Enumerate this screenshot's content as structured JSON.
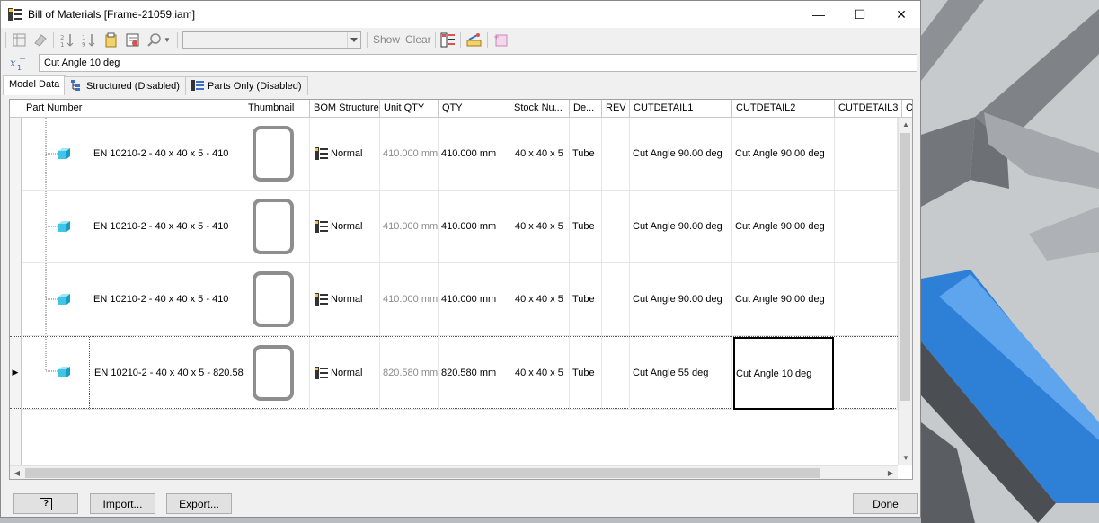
{
  "window": {
    "title": "Bill of Materials [Frame-21059.iam]",
    "minimize_glyph": "—",
    "maximize_glyph": "☐",
    "close_glyph": "✕"
  },
  "toolbar": {
    "view_dropdown_value": "",
    "show_label": "Show",
    "clear_label": "Clear"
  },
  "formula_bar": {
    "value": "Cut Angle 10 deg"
  },
  "tabs": [
    {
      "label": "Model Data",
      "active": true
    },
    {
      "label": "Structured (Disabled)",
      "active": false
    },
    {
      "label": "Parts Only (Disabled)",
      "active": false
    }
  ],
  "grid": {
    "columns": [
      "Part Number",
      "Thumbnail",
      "BOM Structure",
      "Unit QTY",
      "QTY",
      "Stock Nu...",
      "De...",
      "REV",
      "CUTDETAIL1",
      "CUTDETAIL2",
      "CUTDETAIL3",
      "CU"
    ],
    "rows": [
      {
        "part_number": "EN 10210-2 - 40 x 40 x 5 - 410",
        "bom_structure": "Normal",
        "unit_qty": "410.000 mm",
        "qty": "410.000 mm",
        "stock_number": "40 x 40 x 5",
        "description": "Tube",
        "rev": "",
        "cutdetail1": "Cut Angle 90.00 deg",
        "cutdetail2": "Cut Angle 90.00 deg",
        "cutdetail3": ""
      },
      {
        "part_number": "EN 10210-2 - 40 x 40 x 5 - 410",
        "bom_structure": "Normal",
        "unit_qty": "410.000 mm",
        "qty": "410.000 mm",
        "stock_number": "40 x 40 x 5",
        "description": "Tube",
        "rev": "",
        "cutdetail1": "Cut Angle 90.00 deg",
        "cutdetail2": "Cut Angle 90.00 deg",
        "cutdetail3": ""
      },
      {
        "part_number": "EN 10210-2 - 40 x 40 x 5 - 410",
        "bom_structure": "Normal",
        "unit_qty": "410.000 mm",
        "qty": "410.000 mm",
        "stock_number": "40 x 40 x 5",
        "description": "Tube",
        "rev": "",
        "cutdetail1": "Cut Angle 90.00 deg",
        "cutdetail2": "Cut Angle 90.00 deg",
        "cutdetail3": ""
      },
      {
        "part_number": "EN 10210-2 - 40 x 40 x 5 - 820.58",
        "bom_structure": "Normal",
        "unit_qty": "820.580 mm",
        "qty": "820.580 mm",
        "stock_number": "40 x 40 x 5",
        "description": "Tube",
        "rev": "",
        "cutdetail1": "Cut Angle 55 deg",
        "cutdetail2": "Cut Angle 10 deg",
        "cutdetail3": ""
      }
    ]
  },
  "buttons": {
    "help": "?",
    "import": "Import...",
    "export": "Export...",
    "done": "Done"
  }
}
